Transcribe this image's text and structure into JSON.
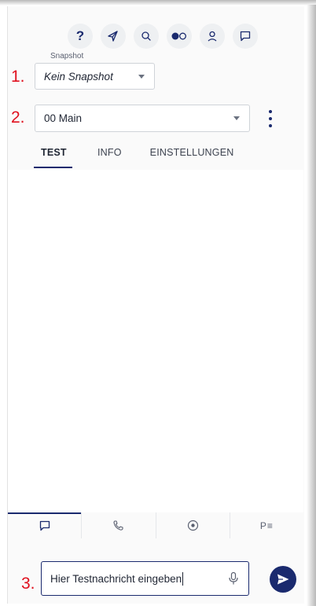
{
  "annotations": {
    "n1": "1.",
    "n2": "2.",
    "n3": "3."
  },
  "toolbar": {
    "help_label": "?",
    "icons": [
      "help-icon",
      "compass-icon",
      "search-icon",
      "toggle-icon",
      "user-icon",
      "chat-icon"
    ]
  },
  "snapshot": {
    "label": "Snapshot",
    "value": "Kein Snapshot"
  },
  "flow": {
    "value": "00 Main"
  },
  "tabs": [
    {
      "label": "TEST",
      "active": true
    },
    {
      "label": "INFO",
      "active": false
    },
    {
      "label": "EINSTELLUNGEN",
      "active": false
    }
  ],
  "bottom_nav": {
    "items": [
      "chat-icon",
      "phone-icon",
      "record-icon",
      "parameter-menu-icon"
    ],
    "p_label": "P≡"
  },
  "message_input": {
    "value": "Hier Testnachricht eingeben"
  },
  "colors": {
    "accent": "#1a2a6e",
    "annotation": "#e0101e",
    "toolbar_bg": "#eef0f2"
  }
}
